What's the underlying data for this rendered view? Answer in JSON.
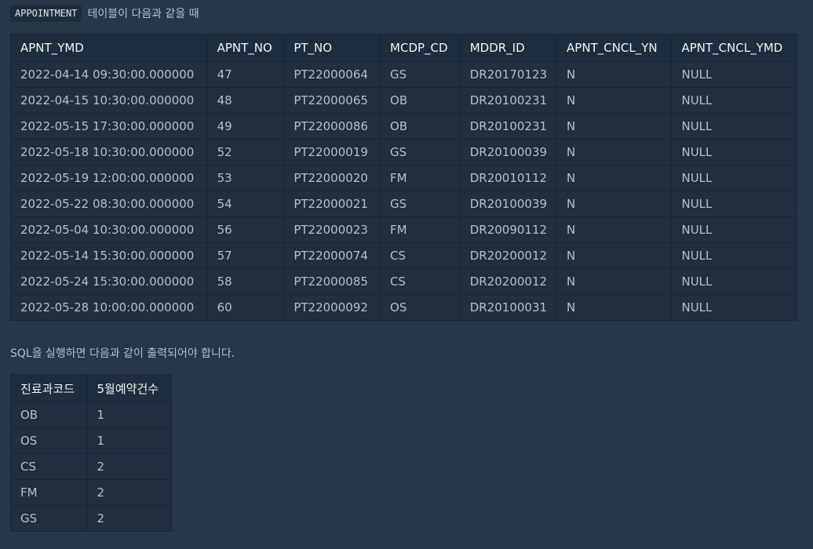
{
  "intro": {
    "table_name": "APPOINTMENT",
    "text": "테이블이 다음과 같을 때"
  },
  "appointment_table": {
    "headers": [
      "APNT_YMD",
      "APNT_NO",
      "PT_NO",
      "MCDP_CD",
      "MDDR_ID",
      "APNT_CNCL_YN",
      "APNT_CNCL_YMD"
    ],
    "rows": [
      [
        "2022-04-14 09:30:00.000000",
        "47",
        "PT22000064",
        "GS",
        "DR20170123",
        "N",
        "NULL"
      ],
      [
        "2022-04-15 10:30:00.000000",
        "48",
        "PT22000065",
        "OB",
        "DR20100231",
        "N",
        "NULL"
      ],
      [
        "2022-05-15 17:30:00.000000",
        "49",
        "PT22000086",
        "OB",
        "DR20100231",
        "N",
        "NULL"
      ],
      [
        "2022-05-18 10:30:00.000000",
        "52",
        "PT22000019",
        "GS",
        "DR20100039",
        "N",
        "NULL"
      ],
      [
        "2022-05-19 12:00:00.000000",
        "53",
        "PT22000020",
        "FM",
        "DR20010112",
        "N",
        "NULL"
      ],
      [
        "2022-05-22 08:30:00.000000",
        "54",
        "PT22000021",
        "GS",
        "DR20100039",
        "N",
        "NULL"
      ],
      [
        "2022-05-04 10:30:00.000000",
        "56",
        "PT22000023",
        "FM",
        "DR20090112",
        "N",
        "NULL"
      ],
      [
        "2022-05-14 15:30:00.000000",
        "57",
        "PT22000074",
        "CS",
        "DR20200012",
        "N",
        "NULL"
      ],
      [
        "2022-05-24 15:30:00.000000",
        "58",
        "PT22000085",
        "CS",
        "DR20200012",
        "N",
        "NULL"
      ],
      [
        "2022-05-28 10:00:00.000000",
        "60",
        "PT22000092",
        "OS",
        "DR20100031",
        "N",
        "NULL"
      ]
    ]
  },
  "result_intro": "SQL을 실행하면 다음과 같이 출력되어야 합니다.",
  "result_table": {
    "headers": [
      "진료과코드",
      "5월예약건수"
    ],
    "rows": [
      [
        "OB",
        "1"
      ],
      [
        "OS",
        "1"
      ],
      [
        "CS",
        "2"
      ],
      [
        "FM",
        "2"
      ],
      [
        "GS",
        "2"
      ]
    ]
  }
}
